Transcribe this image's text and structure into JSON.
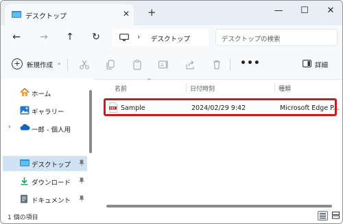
{
  "window": {
    "tab_title": "デスクトップ",
    "tab_close": "✕",
    "new_tab": "+",
    "controls": {
      "minimize": "—",
      "maximize": "☐",
      "close": "✕"
    }
  },
  "address_bar": {
    "back": "←",
    "forward": "→",
    "up": "↑",
    "refresh": "↻",
    "chevron": "›",
    "location": "デスクトップ",
    "search_placeholder": "デスクトップの検索"
  },
  "toolbar": {
    "new_label": "新規作成",
    "new_dropdown": "⌄",
    "more": "•••",
    "details_label": "詳細"
  },
  "nav_pane": {
    "items": [
      {
        "label": "ホーム",
        "icon": "home-icon"
      },
      {
        "label": "ギャラリー",
        "icon": "gallery-icon"
      },
      {
        "label": "一郎 - 個人用",
        "icon": "onedrive-cloud-icon",
        "expander": "›"
      },
      {
        "label": "デスクトップ",
        "icon": "desktop-folder-icon",
        "selected": true,
        "pinned": true
      },
      {
        "label": "ダウンロード",
        "icon": "download-icon",
        "pinned": true
      },
      {
        "label": "ドキュメント",
        "icon": "document-icon",
        "pinned": true
      }
    ],
    "pin_glyph": "📌"
  },
  "file_list": {
    "columns": {
      "name": "名前",
      "modified": "日付時刻",
      "type": "種類"
    },
    "sort_caret": "^",
    "rows": [
      {
        "name": "Sample",
        "modified": "2024/02/29 9:42",
        "type": "Microsoft Edge P...",
        "icon": "pdf-icon",
        "highlight_color": "#d6141c"
      }
    ]
  },
  "status_bar": {
    "item_count": "1 個の項目"
  }
}
